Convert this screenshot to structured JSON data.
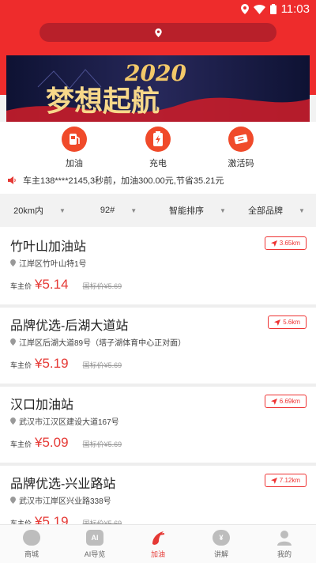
{
  "status_bar": {
    "time": "11:03"
  },
  "banner": {
    "year": "2020",
    "slogan": "梦想起航"
  },
  "quick_actions": [
    {
      "label": "加油",
      "icon": "fuel-pump-icon"
    },
    {
      "label": "充电",
      "icon": "battery-charge-icon"
    },
    {
      "label": "激活码",
      "icon": "ticket-icon"
    }
  ],
  "notice": {
    "text": "车主138****2145,3秒前，加油300.00元,节省35.21元"
  },
  "filters": [
    {
      "label": "20km内"
    },
    {
      "label": "92#"
    },
    {
      "label": "智能排序"
    },
    {
      "label": "全部品牌"
    }
  ],
  "price_label": "车主价",
  "stations": [
    {
      "name": "竹叶山加油站",
      "distance": "3.65km",
      "address": "江岸区竹叶山特1号",
      "price": "¥5.14",
      "national": "国标价¥5.69"
    },
    {
      "name": "品牌优选-后湖大道站",
      "distance": "5.6km",
      "address": "江岸区后湖大道89号（塔子湖体育中心正对面）",
      "price": "¥5.19",
      "national": "国标价¥5.69"
    },
    {
      "name": "汉口加油站",
      "distance": "6.69km",
      "address": "武汉市江汉区建设大道167号",
      "price": "¥5.09",
      "national": "国标价¥5.69"
    },
    {
      "name": "品牌优选-兴业路站",
      "distance": "7.12km",
      "address": "武汉市江岸区兴业路338号",
      "price": "¥5.19",
      "national": "国标价¥5.69"
    }
  ],
  "tabs": [
    {
      "label": "商城",
      "icon": "store-icon"
    },
    {
      "label": "AI导览",
      "icon": "ai-icon",
      "glyph": "AI"
    },
    {
      "label": "加油",
      "icon": "fuel-icon"
    },
    {
      "label": "讲解",
      "icon": "yen-icon",
      "glyph": "¥"
    },
    {
      "label": "我的",
      "icon": "person-icon"
    }
  ],
  "active_tab": "加油",
  "colors": {
    "brand_red": "#ee2c2c",
    "price_red": "#e53935",
    "banner_bg": "#1b1d48"
  }
}
